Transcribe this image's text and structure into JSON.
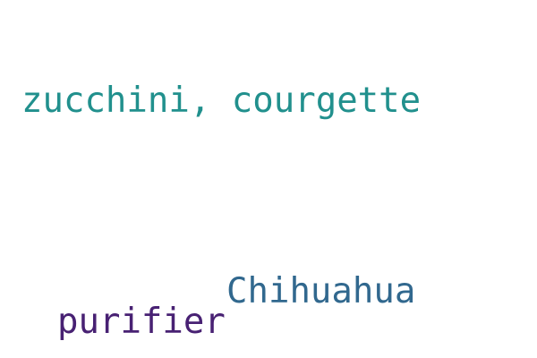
{
  "words": [
    {
      "text": "zucchini, courgette",
      "color": "#21908d"
    },
    {
      "text": "Chihuahua",
      "color": "#31688e"
    },
    {
      "text": "purifier",
      "color": "#482173"
    }
  ]
}
